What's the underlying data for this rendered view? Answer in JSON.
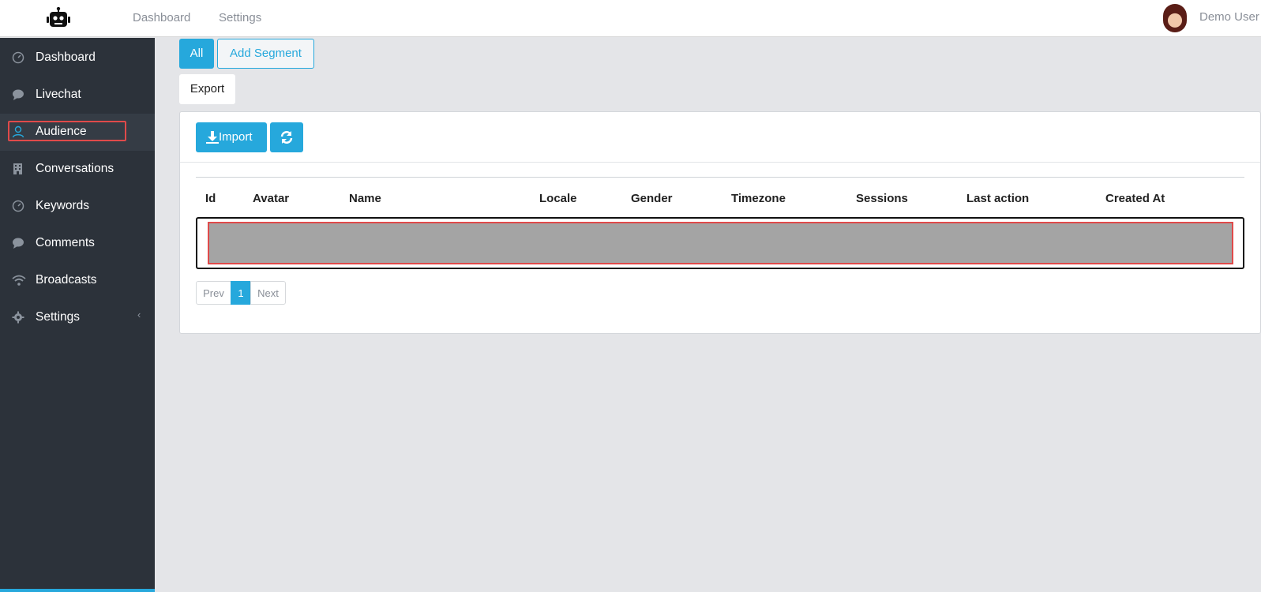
{
  "topbar": {
    "nav": [
      "Dashboard",
      "Settings"
    ],
    "user_name": "Demo User"
  },
  "sidebar": {
    "items": [
      {
        "label": "Dashboard",
        "icon": "dashboard-gauge-icon"
      },
      {
        "label": "Livechat",
        "icon": "chat-bubble-icon"
      },
      {
        "label": "Audience",
        "icon": "user-icon"
      },
      {
        "label": "Conversations",
        "icon": "building-icon"
      },
      {
        "label": "Keywords",
        "icon": "dashboard-gauge-icon"
      },
      {
        "label": "Comments",
        "icon": "chat-bubble-icon"
      },
      {
        "label": "Broadcasts",
        "icon": "wifi-icon"
      },
      {
        "label": "Settings",
        "icon": "gear-icon"
      }
    ],
    "active_item": "Audience"
  },
  "segments": {
    "all_label": "All",
    "add_label": "Add Segment"
  },
  "export_label": "Export",
  "toolbar": {
    "import_label": "Import"
  },
  "table": {
    "columns": [
      "Id",
      "Avatar",
      "Name",
      "Locale",
      "Gender",
      "Timezone",
      "Sessions",
      "Last action",
      "Created At"
    ]
  },
  "pagination": {
    "prev": "Prev",
    "current": "1",
    "next": "Next"
  },
  "colors": {
    "accent": "#26a8dc",
    "sidebar_bg": "#2c323a",
    "page_bg": "#e4e5e8",
    "highlight": "#e04a4a"
  }
}
